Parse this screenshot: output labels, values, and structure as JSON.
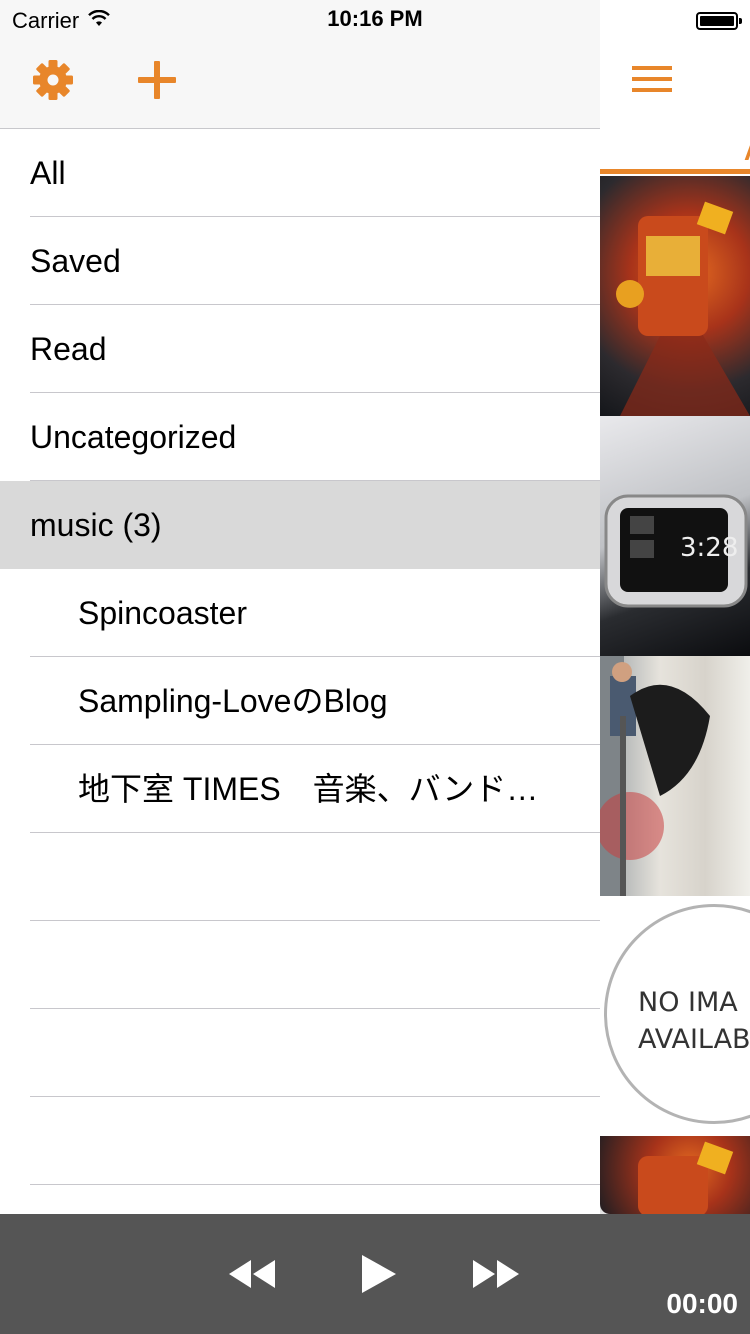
{
  "status_bar": {
    "carrier": "Carrier",
    "time": "10:16 PM",
    "icons": [
      "wifi-icon",
      "battery-icon"
    ]
  },
  "menu": {
    "toolbar": {
      "icons": [
        "gear-icon",
        "plus-icon"
      ]
    },
    "items": [
      {
        "label": "All"
      },
      {
        "label": "Saved"
      },
      {
        "label": "Read"
      },
      {
        "label": "Uncategorized"
      },
      {
        "label": "music (3)",
        "selected": true
      },
      {
        "label": "Spincoaster",
        "indent": true
      },
      {
        "label": "Sampling-LoveのBlog",
        "indent": true
      },
      {
        "label": "地下室 TIMES　音楽、バンド…",
        "indent": true
      }
    ]
  },
  "feed": {
    "tab_label": "A",
    "no_image": {
      "line1": "NO IMA",
      "line2": "AVAILAB"
    }
  },
  "player": {
    "time": "00:00",
    "icons": [
      "rewind-icon",
      "play-icon",
      "fast-forward-icon"
    ]
  },
  "colors": {
    "accent": "#e8862a",
    "toolbar_bg": "#f7f7f7",
    "selected_row_bg": "#d9d9d9",
    "player_bg": "#555555",
    "separator": "#c8c7cc"
  }
}
